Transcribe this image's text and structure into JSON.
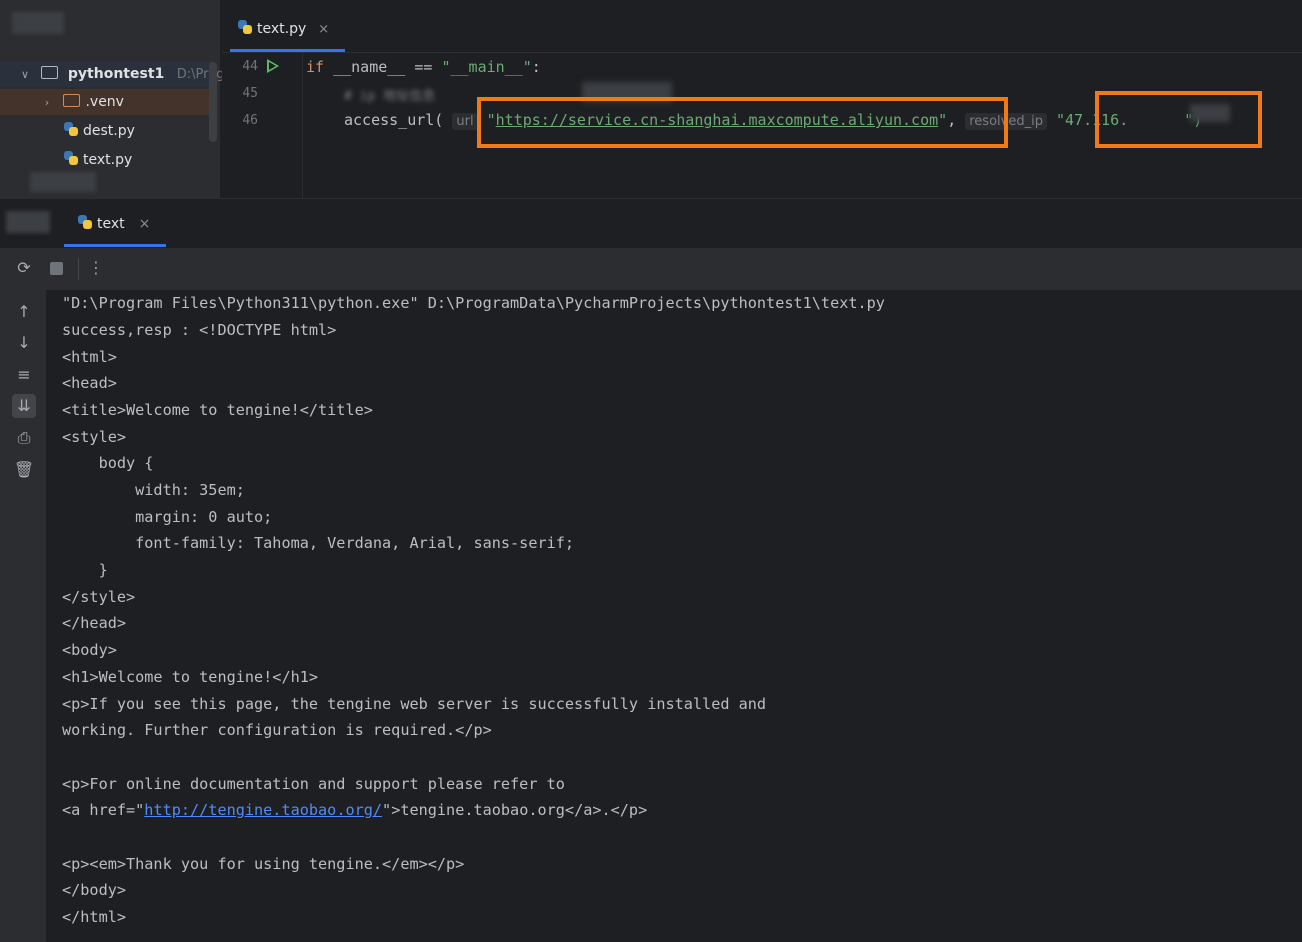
{
  "project": {
    "name": "pythontest1",
    "path": "D:\\Progr",
    "items": [
      {
        "label": ".venv",
        "type": "folder"
      },
      {
        "label": "dest.py",
        "type": "python-file"
      },
      {
        "label": "text.py",
        "type": "python-file"
      }
    ]
  },
  "editor": {
    "tab_label": "text.py",
    "tab_close": "×",
    "line_numbers": [
      "44",
      "45",
      "46"
    ],
    "line44": {
      "kw": "if",
      "rest": " __name__ == ",
      "str": "\"__main__\"",
      "end": ":"
    },
    "line45": "# ip 地址信息",
    "line46": {
      "fn": "access_url(",
      "hint_url": "url",
      "url_open": "\"",
      "url": "https://service.cn-shanghai.maxcompute.aliyun.com",
      "url_close": "\"",
      "comma": ",",
      "hint_ip": "resolved_ip",
      "ip": "\"47.116.",
      "ip_close": "\")"
    }
  },
  "run_panel": {
    "tab_label": "text",
    "tab_close": "×",
    "more": "⋮"
  },
  "console_lines": [
    "\"D:\\Program Files\\Python311\\python.exe\" D:\\ProgramData\\PycharmProjects\\pythontest1\\text.py",
    "success,resp : <!DOCTYPE html>",
    "<html>",
    "<head>",
    "<title>Welcome to tengine!</title>",
    "<style>",
    "    body {",
    "        width: 35em;",
    "        margin: 0 auto;",
    "        font-family: Tahoma, Verdana, Arial, sans-serif;",
    "    }",
    "</style>",
    "</head>",
    "<body>",
    "<h1>Welcome to tengine!</h1>",
    "<p>If you see this page, the tengine web server is successfully installed and",
    "working. Further configuration is required.</p>",
    "",
    "<p>For online documentation and support please refer to",
    "",
    "",
    "<p><em>Thank you for using tengine.</em></p>",
    "</body>",
    "</html>"
  ],
  "console_link_line": {
    "before": "<a href=\"",
    "link": "http://tengine.taobao.org/",
    "after": "\">tengine.taobao.org</a>.</p>"
  },
  "colors": {
    "highlight_box": "#f07a1a",
    "accent": "#3574f0",
    "string": "#6aab73",
    "keyword": "#cf8e6d"
  }
}
